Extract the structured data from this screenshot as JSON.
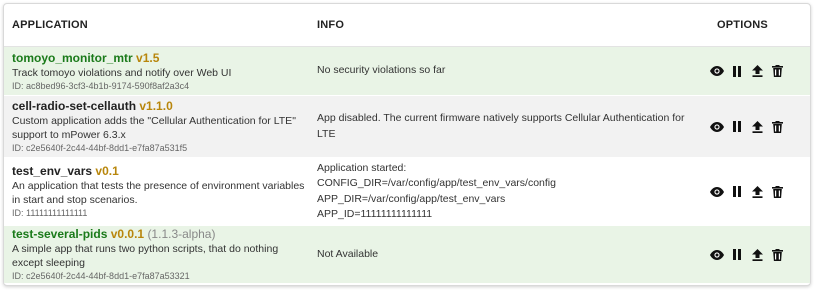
{
  "header": {
    "application": "APPLICATION",
    "info": "INFO",
    "options": "OPTIONS"
  },
  "apps": [
    {
      "name": "tomoyo_monitor_mtr",
      "version": "v1.5",
      "extra": "",
      "description": "Track tomoyo violations and notify over Web UI",
      "id": "ID: ac8bed96-3cf3-4b1b-9174-590f8af2a3c4",
      "info": "No security violations so far"
    },
    {
      "name": "cell-radio-set-cellauth",
      "version": "v1.1.0",
      "extra": "",
      "description": "Custom application adds the \"Cellular Authentication for LTE\" support to mPower 6.3.x",
      "id": "ID: c2e5640f-2c44-44bf-8dd1-e7fa87a531f5",
      "info": "App disabled. The current firmware natively supports Cellular Authentication for LTE"
    },
    {
      "name": "test_env_vars",
      "version": "v0.1",
      "extra": "",
      "description": "An application that tests the presence of environment variables in start and stop scenarios.",
      "id": "ID: 11111111111111",
      "info_lines": [
        "Application started:",
        "CONFIG_DIR=/var/config/app/test_env_vars/config",
        "APP_DIR=/var/config/app/test_env_vars",
        "APP_ID=11111111111111"
      ]
    },
    {
      "name": "test-several-pids",
      "version": "v0.0.1",
      "extra": "(1.1.3-alpha)",
      "description": "A simple app that runs two python scripts, that do nothing except sleeping",
      "id": "ID: c2e5640f-2c44-44bf-8dd1-e7fa87a53321",
      "info": "Not Available"
    }
  ],
  "option_icons": [
    "eye-icon",
    "pause-icon",
    "upload-icon",
    "trash-icon"
  ],
  "colors": {
    "green_name": "#1a7a1a",
    "version": "#b8860b",
    "row_green": "#e9f4e6",
    "row_grey": "#f2f2f2"
  }
}
